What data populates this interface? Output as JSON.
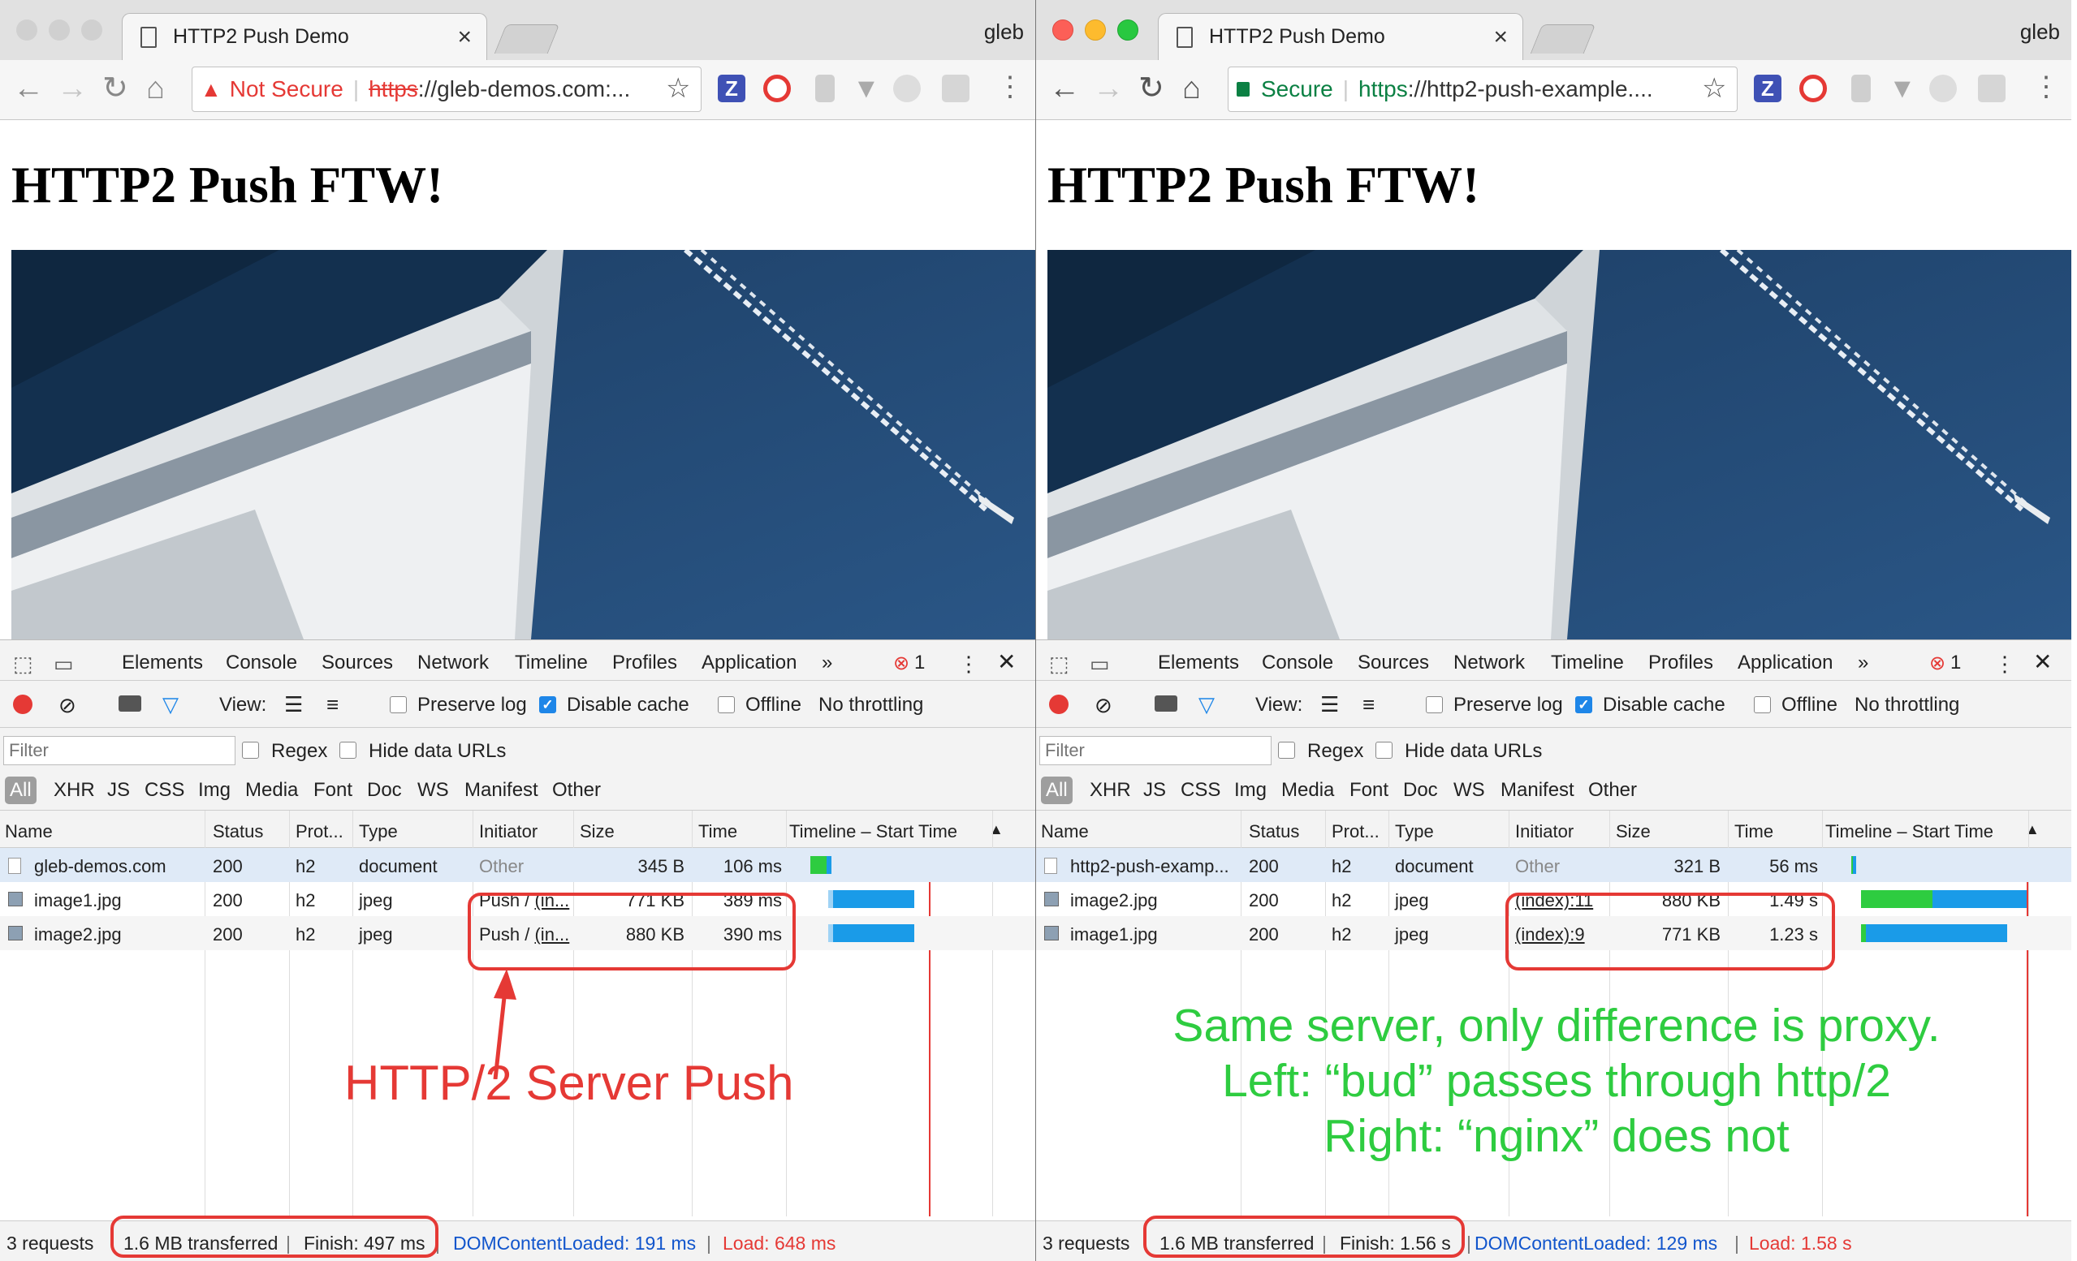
{
  "left": {
    "tab_title": "HTTP2 Push Demo",
    "user": "gleb",
    "security_label": "Not Secure",
    "url_scheme": "https",
    "url_rest": "://gleb-demos.com:...",
    "heading": "HTTP2 Push FTW!",
    "rows": [
      {
        "name": "gleb-demos.com",
        "status": "200",
        "protocol": "h2",
        "type": "document",
        "initiator": "Other",
        "size": "345 B",
        "time": "106 ms"
      },
      {
        "name": "image1.jpg",
        "status": "200",
        "protocol": "h2",
        "type": "jpeg",
        "initiator_prefix": "Push / ",
        "initiator_link": "(in...",
        "size": "771 KB",
        "time": "389 ms"
      },
      {
        "name": "image2.jpg",
        "status": "200",
        "protocol": "h2",
        "type": "jpeg",
        "initiator_prefix": "Push / ",
        "initiator_link": "(in...",
        "size": "880 KB",
        "time": "390 ms"
      }
    ],
    "status": {
      "requests": "3 requests",
      "transferred": "1.6 MB transferred",
      "finish": "Finish: 497 ms",
      "dom": "DOMContentLoaded: 191 ms",
      "load": "Load: 648 ms"
    },
    "error_count": "1",
    "annotation": "HTTP/2 Server Push"
  },
  "right": {
    "tab_title": "HTTP2 Push Demo",
    "user": "gleb",
    "security_label": "Secure",
    "url_scheme": "https",
    "url_rest": "://http2-push-example....",
    "heading": "HTTP2 Push FTW!",
    "rows": [
      {
        "name": "http2-push-examp...",
        "status": "200",
        "protocol": "h2",
        "type": "document",
        "initiator": "Other",
        "size": "321 B",
        "time": "56 ms"
      },
      {
        "name": "image2.jpg",
        "status": "200",
        "protocol": "h2",
        "type": "jpeg",
        "initiator": "(index):11",
        "size": "880 KB",
        "time": "1.49 s"
      },
      {
        "name": "image1.jpg",
        "status": "200",
        "protocol": "h2",
        "type": "jpeg",
        "initiator": "(index):9",
        "size": "771 KB",
        "time": "1.23 s"
      }
    ],
    "status": {
      "requests": "3 requests",
      "transferred": "1.6 MB transferred",
      "finish": "Finish: 1.56 s",
      "dom": "DOMContentLoaded: 129 ms",
      "load": "Load: 1.58 s"
    },
    "error_count": "1",
    "annotation": [
      "Same server, only difference is proxy.",
      "Left: “bud” passes through http/2",
      "Right: “nginx” does not"
    ]
  },
  "devtools": {
    "tabs": [
      "Elements",
      "Console",
      "Sources",
      "Network",
      "Timeline",
      "Profiles",
      "Application"
    ],
    "more": "»",
    "view_label": "View:",
    "preserve_log": "Preserve log",
    "disable_cache": "Disable cache",
    "offline": "Offline",
    "throttling": "No throttling",
    "filter_placeholder": "Filter",
    "regex": "Regex",
    "hide_data_urls": "Hide data URLs",
    "types": [
      "All",
      "XHR",
      "JS",
      "CSS",
      "Img",
      "Media",
      "Font",
      "Doc",
      "WS",
      "Manifest",
      "Other"
    ],
    "columns": [
      "Name",
      "Status",
      "Prot...",
      "Type",
      "Initiator",
      "Size",
      "Time",
      "Timeline – Start Time"
    ],
    "sort_arrow": "▲"
  },
  "colors": {
    "red": "#e53935",
    "green": "#2ecc40",
    "blue": "#1a9be8",
    "link_blue": "#1155cc"
  }
}
